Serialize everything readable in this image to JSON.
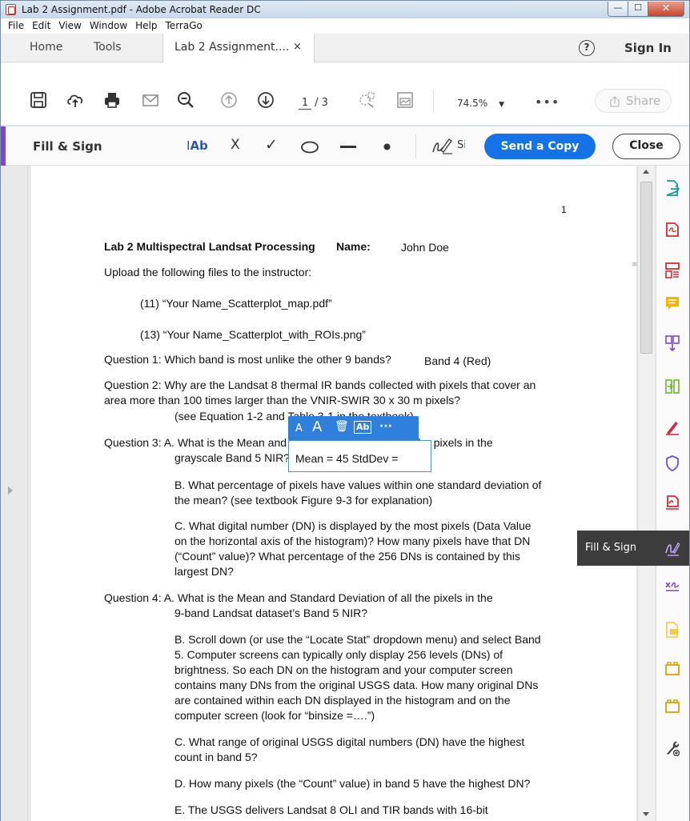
{
  "window": {
    "title": "Lab 2 Assignment.pdf - Adobe Acrobat Reader DC",
    "min_glyph": "—",
    "max_glyph": "☐",
    "close_glyph": "✕"
  },
  "menu": [
    "File",
    "Edit",
    "View",
    "Window",
    "Help",
    "TerraGo"
  ],
  "tabs": {
    "home": "Home",
    "tools": "Tools",
    "doc": "Lab 2 Assignment....",
    "doc_close": "×",
    "help": "?",
    "signin": "Sign In"
  },
  "toolbar": {
    "page_current": "1",
    "page_total": "/ 3",
    "zoom": "74.5%",
    "zoom_caret": "▼",
    "more": "•••",
    "share": "Share",
    "icons": [
      "save-icon",
      "upload-icon",
      "print-icon",
      "email-icon",
      "zoom-out-icon",
      "page-up-icon",
      "page-down-icon",
      "select-icon",
      "thumbnails-icon"
    ]
  },
  "fillsign": {
    "title": "Fill & Sign",
    "text_tool": "Ab",
    "cross": "X",
    "check": "✓",
    "sign": "Sig",
    "send_copy": "Send a Copy",
    "close": "Close",
    "accent": "#7b48c7",
    "button_color": "#1473e6"
  },
  "document": {
    "page_number": "1",
    "header_title": "Lab 2 Multispectral Landsat Processing",
    "header_name_label": "Name:",
    "header_name_value": "John Doe",
    "lines": [
      "Upload the following files to the instructor:",
      "(11) “Your Name_Scatterplot_map.pdf”",
      "(13) “Your Name_Scatterplot_with_ROIs.png”",
      "Question 1: Which band is most unlike the other 9 bands?",
      "Band 4 (Red)",
      "Question 2: Why are the Landsat 8 thermal IR bands collected with pixels that cover an",
      "area more than 100 times larger than the VNIR-SWIR 30 x 30 m pixels?",
      "(see Equation 1-2 and Table 3-1 in the textbook)",
      "Question 3:  A. What is the Mean and Standard Deviation of all the pixels in the",
      "grayscale Band 5 NIR?",
      "B. What percentage of pixels have values within one standard deviation of",
      "the mean?  (see textbook Figure 9-3 for explanation)",
      "C. What digital number (DN) is displayed by the most pixels (Data Value",
      "on the horizontal axis of the histogram)?  How many pixels have that DN",
      "(“Count” value)?  What percentage of the 256 DNs is contained by this",
      "largest DN?",
      "Question 4:  A. What is the Mean and Standard Deviation of all the pixels in the",
      "9-band Landsat dataset’s Band 5 NIR?",
      "B.  Scroll down (or use the “Locate Stat” dropdown menu) and select Band",
      "5.   Computer screens can typically only display 256 levels (DNs) of",
      "brightness. So each DN on the histogram and your computer screen",
      "contains many DNs from the original USGS data.  How many original DNs",
      "are contained within each DN displayed in the histogram and on the",
      "computer screen (look for “binsize =….”)",
      "C. What range of original USGS digital numbers (DN) have the highest",
      "count in band 5?",
      "D. How many pixels (the “Count” value) in band 5 have the highest DN?",
      "E. The USGS delivers Landsat 8 OLI and TIR bands with 16-bit"
    ]
  },
  "popup": {
    "small_a": "A",
    "large_a": "A",
    "trash": "🗑",
    "field_type": "Ab",
    "more": "···",
    "field_text": "Mean = 45   StdDev ="
  },
  "right_panel": {
    "tooltip": "Fill & Sign",
    "icons": [
      "export-pdf-icon",
      "create-pdf-icon",
      "organize-pages-icon",
      "comment-icon",
      "combine-files-icon",
      "compress-icon",
      "fill-sign-pen-icon",
      "protect-icon",
      "pdf-icon",
      "fill-sign-icon",
      "sign-icon",
      "send-file-icon",
      "folder-icon",
      "folder-icon",
      "tools-icon"
    ]
  }
}
